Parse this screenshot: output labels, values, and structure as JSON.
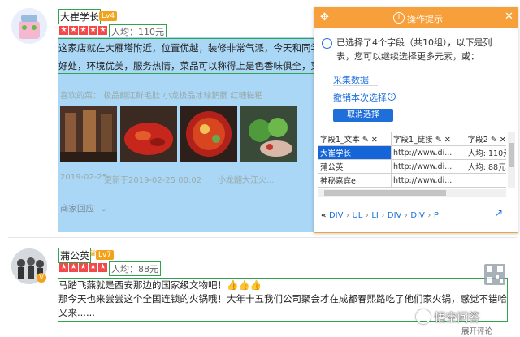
{
  "reviews": [
    {
      "name": "大崔学长",
      "level": "Lv4",
      "price": "人均：110元",
      "text_lines": [
        "这家店就在大雁塔附近，位置优越，装修非常气派，今天和同学一起去",
        "好处，环境优美，服务热情，菜品可以称得上是色香味俱全，菜品......"
      ],
      "dishes_label": "喜欢的菜：",
      "dishes": "极品翻江鲜毛肚 小龙极品冰球鹅肠 红糖糍粑",
      "date": "2019-02-25",
      "updated": "更新于2019-02-25 00:02",
      "shop": "小龙翻大江火...",
      "reply": "商家回应"
    },
    {
      "name": "蒲公英",
      "level": "Lv7",
      "price": "人均：88元",
      "text_lines": [
        "马踏飞燕就是西安那边的国家级文物吧！👍👍👍",
        "那今天也来尝尝这个全国连锁的火锅哦！大年十五我们公司聚会才在成都春熙路吃了他们家火锅，感觉不错哈！所以现在",
        "又来......"
      ]
    }
  ],
  "panel": {
    "title": "操作提示",
    "message": "已选择了4个字段（共10组），以下是列表，您可以继续选择更多元素，或：",
    "collect": "采集数据",
    "undo": "撤销本次选择",
    "cancel": "取消选择",
    "columns": [
      "字段1_文本",
      "字段1_链接",
      "字段2",
      "字段"
    ],
    "rows": [
      [
        "大崔学长",
        "http://www.di...",
        "人均: 110元",
        "这家"
      ],
      [
        "蒲公英",
        "http://www.di...",
        "人均: 88元",
        "马踏"
      ],
      [
        "神秘嘉宾e",
        "http://www.di...",
        "",
        "开了"
      ]
    ],
    "breadcrumb": [
      "DIV",
      "UL",
      "LI",
      "DIV",
      "DIV",
      "P"
    ]
  },
  "watermark": "悟空问答",
  "footer_link": "展开评论"
}
